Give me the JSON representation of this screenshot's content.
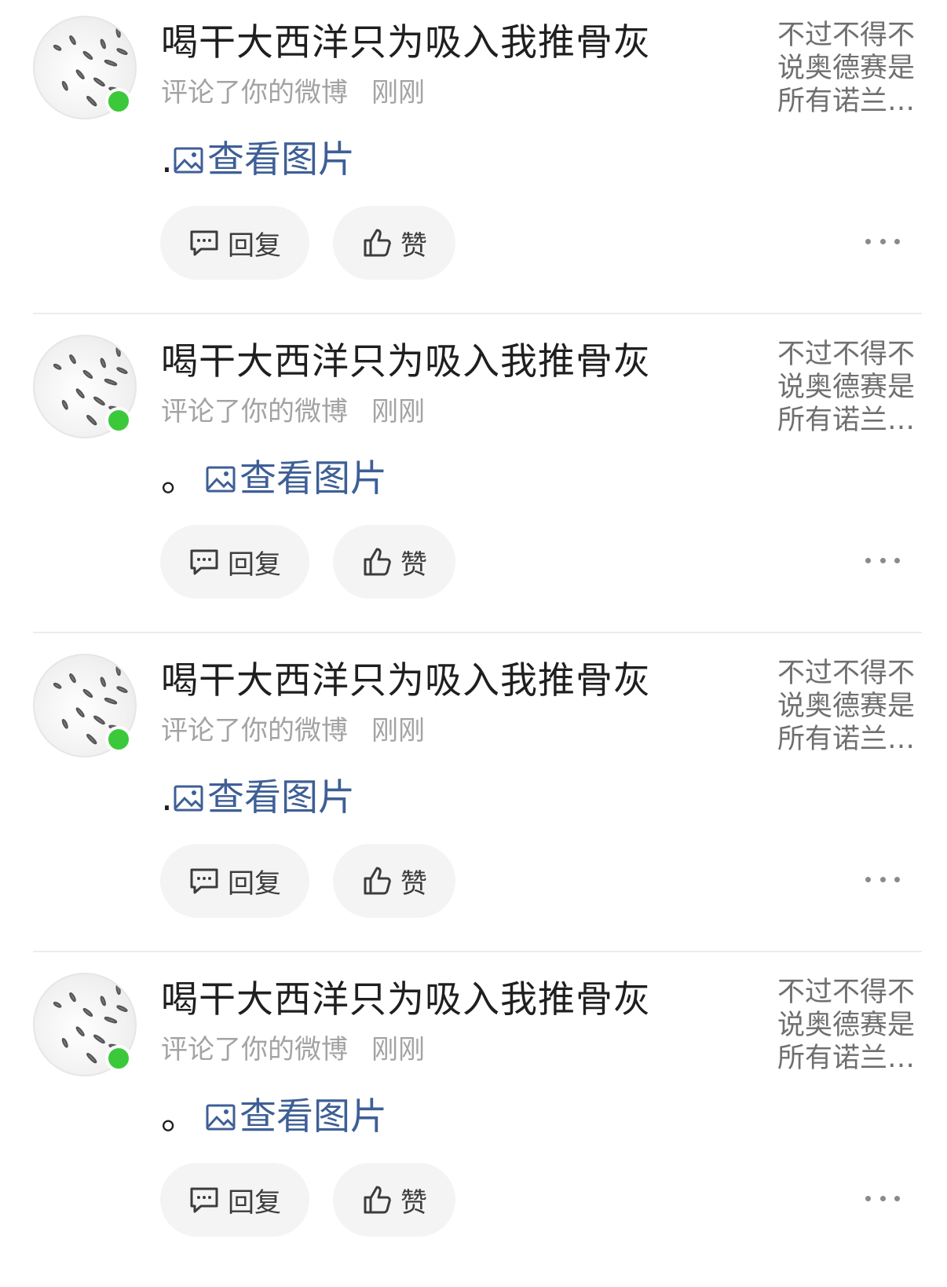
{
  "accent_color": "#3e5f96",
  "online_color": "#3bc93b",
  "notifications": [
    {
      "username": "喝干大西洋只为吸入我推骨灰",
      "action": "评论了你的微博",
      "time": "刚刚",
      "content_punct": ".",
      "view_image_label": "查看图片",
      "quoted_text": "不过不得不说奥德赛是所有诺兰…",
      "reply_label": "回复",
      "like_label": "赞",
      "avatar_icon": "avatar-image",
      "more_icon": "more-horizontal-icon"
    },
    {
      "username": "喝干大西洋只为吸入我推骨灰",
      "action": "评论了你的微博",
      "time": "刚刚",
      "content_punct": "。",
      "view_image_label": "查看图片",
      "quoted_text": "不过不得不说奥德赛是所有诺兰…",
      "reply_label": "回复",
      "like_label": "赞",
      "avatar_icon": "avatar-image",
      "more_icon": "more-horizontal-icon"
    },
    {
      "username": "喝干大西洋只为吸入我推骨灰",
      "action": "评论了你的微博",
      "time": "刚刚",
      "content_punct": ".",
      "view_image_label": "查看图片",
      "quoted_text": "不过不得不说奥德赛是所有诺兰…",
      "reply_label": "回复",
      "like_label": "赞",
      "avatar_icon": "avatar-image",
      "more_icon": "more-horizontal-icon"
    },
    {
      "username": "喝干大西洋只为吸入我推骨灰",
      "action": "评论了你的微博",
      "time": "刚刚",
      "content_punct": "。",
      "view_image_label": "查看图片",
      "quoted_text": "不过不得不说奥德赛是所有诺兰…",
      "reply_label": "回复",
      "like_label": "赞",
      "avatar_icon": "avatar-image",
      "more_icon": "more-horizontal-icon"
    }
  ]
}
